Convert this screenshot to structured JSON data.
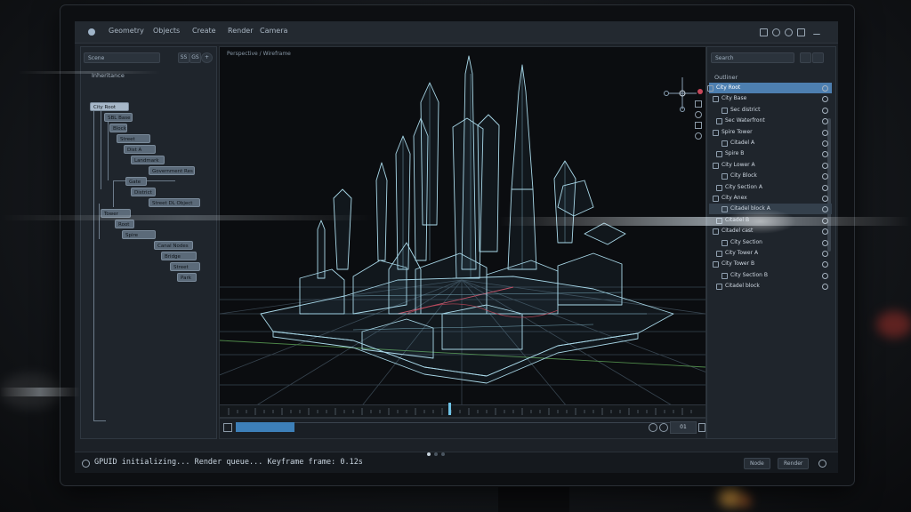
{
  "menubar": {
    "items": [
      "Geometry",
      "Objects",
      "Create",
      "Render",
      "Camera"
    ]
  },
  "left_panel": {
    "title": "Inheritance",
    "search_placeholder": "Scene",
    "button_labels": [
      "SS",
      "GS"
    ],
    "nodes": [
      "City Root",
      "SBL Base",
      "Block",
      "Street",
      "Dist A",
      "Landmark",
      "Government Res",
      "Gate",
      "District",
      "Street DL Object",
      "Tower",
      "Root",
      "Spire",
      "Canal Nodes",
      "Bridge",
      "Street",
      "Park"
    ]
  },
  "viewport": {
    "header": "Perspective / Wireframe"
  },
  "right_panel": {
    "search_placeholder": "Search",
    "title": "Outliner",
    "rows": [
      "City Root",
      "City Base",
      "Sec district",
      "Sec Waterfront",
      "Spire Tower",
      "Citadel A",
      "Spire B",
      "City Lower A",
      "City Block",
      "City Section A",
      "City Anex",
      "Citadel block A",
      "Citadel B",
      "Citadel cast",
      "City Section",
      "City Tower A",
      "City Tower B",
      "City Section B",
      "Citadel block"
    ],
    "selected_row": 0,
    "highlighted_row": 11
  },
  "timeline": {
    "playhead_fraction": 0.47,
    "range_fraction": 0.12,
    "frame_field": "01"
  },
  "status": {
    "text": "GPUID initializing... Render queue... Keyframe frame: 0.12s",
    "buttons": [
      "Node",
      "Render"
    ]
  },
  "colors": {
    "accent": "#4d7fb0",
    "wire": "#a9d8e8",
    "grid": "#3a4854",
    "axis_red": "#c8475a",
    "axis_green": "#4f8a4a"
  }
}
